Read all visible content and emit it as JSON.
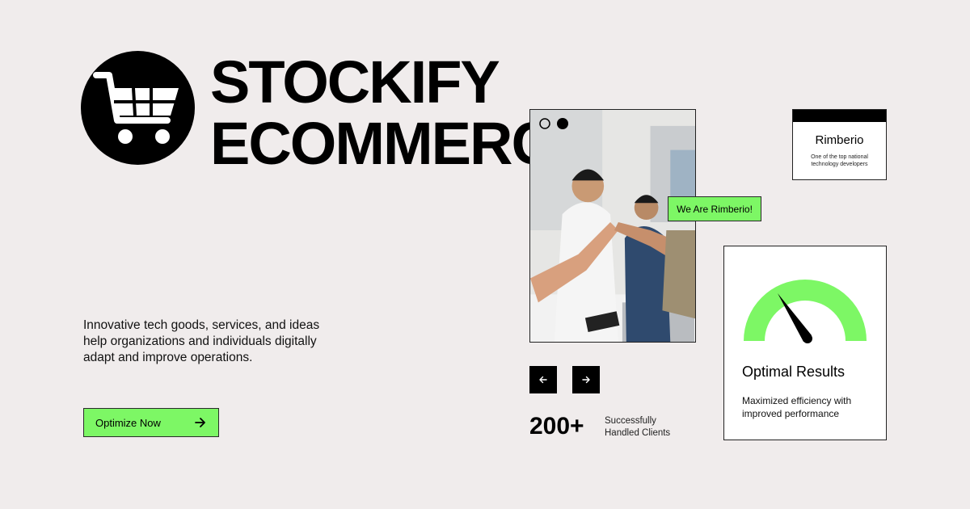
{
  "brand": {
    "title_line1": "STOCKIFY",
    "title_line2": "ECOMMERCE",
    "logo_icon": "shopping-cart-icon"
  },
  "hero": {
    "tagline": "Innovative tech goods, services, and ideas help organizations and individuals digitally adapt and improve operations.",
    "cta_label": "Optimize Now",
    "cta_icon": "arrow-right-icon"
  },
  "badge": {
    "label": "We Are Rimberio!"
  },
  "company_card": {
    "name": "Rimberio",
    "description": "One of the top national technology developers"
  },
  "carousel": {
    "prev_icon": "arrow-left-icon",
    "next_icon": "arrow-right-icon"
  },
  "stats": {
    "value": "200+",
    "label": "Successfully Handled Clients"
  },
  "results_card": {
    "title": "Optimal Results",
    "description": "Maximized efficiency with improved performance",
    "gauge_icon": "speedometer-gauge-icon"
  },
  "colors": {
    "background": "#f0ecec",
    "accent": "#7df765",
    "dark": "#000000"
  }
}
